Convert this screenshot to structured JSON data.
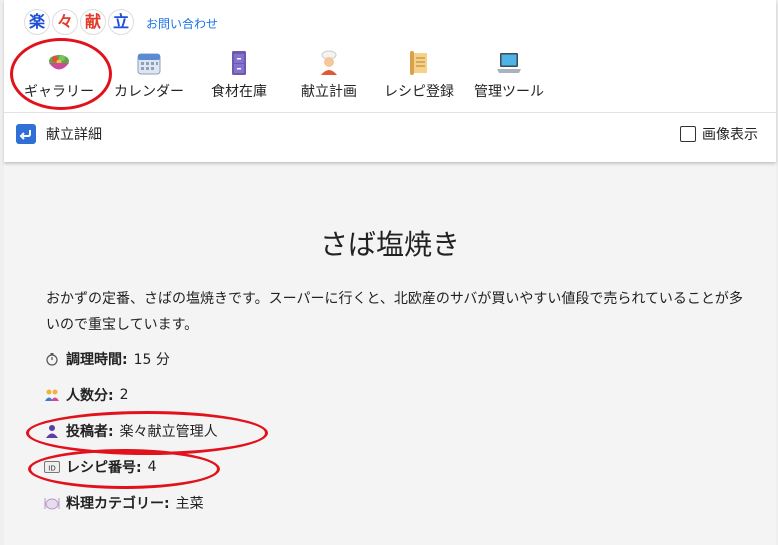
{
  "header": {
    "logo_chars": [
      "楽",
      "々",
      "献",
      "立"
    ],
    "contact_link": "お問い合わせ"
  },
  "nav": {
    "items": [
      {
        "label": "ギャラリー",
        "icon": "salad-bowl-icon"
      },
      {
        "label": "カレンダー",
        "icon": "calendar-icon"
      },
      {
        "label": "食材在庫",
        "icon": "cabinet-icon"
      },
      {
        "label": "献立計画",
        "icon": "chef-icon"
      },
      {
        "label": "レシピ登録",
        "icon": "scroll-icon"
      },
      {
        "label": "管理ツール",
        "icon": "laptop-icon"
      }
    ]
  },
  "subheader": {
    "back_label": "献立詳細",
    "image_toggle_label": "画像表示",
    "image_toggle_checked": false
  },
  "recipe": {
    "title": "さば塩焼き",
    "description": "おかずの定番、さばの塩焼きです。スーパーに行くと、北欧産のサバが買いやすい値段で売られていることが多いので重宝しています。",
    "cook_time": {
      "label": "調理時間:",
      "value": "15 分",
      "icon": "stopwatch-icon"
    },
    "servings": {
      "label": "人数分:",
      "value": "2",
      "icon": "people-icon"
    },
    "author": {
      "label": "投稿者:",
      "value": "楽々献立管理人",
      "icon": "person-icon"
    },
    "recipe_id": {
      "label": "レシピ番号:",
      "value": "4",
      "icon": "id-icon"
    },
    "category": {
      "label": "料理カテゴリー:",
      "value": "主菜",
      "icon": "plate-icon"
    }
  },
  "colors": {
    "annotation": "#e2121c",
    "link": "#1a73e8",
    "back_icon": "#2f6fd6"
  }
}
